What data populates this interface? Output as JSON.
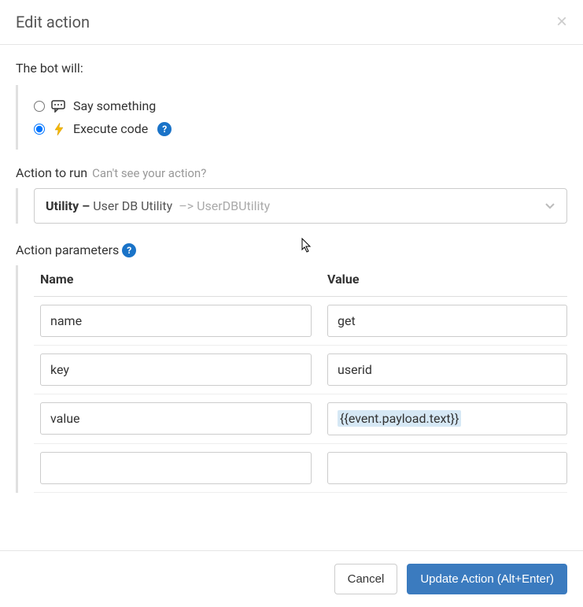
{
  "modal": {
    "title": "Edit action",
    "close_label": "×"
  },
  "bot_will": {
    "label": "The bot will:",
    "options": {
      "say": "Say something",
      "execute": "Execute code"
    },
    "selected": "execute"
  },
  "action_to_run": {
    "label": "Action to run",
    "hint": "Can't see your action?",
    "selected": {
      "category": "Utility –",
      "name": "User DB Utility",
      "identifier": "–> UserDBUtility"
    }
  },
  "action_parameters": {
    "label": "Action parameters",
    "columns": {
      "name": "Name",
      "value": "Value"
    },
    "rows": [
      {
        "name": "name",
        "value": "get"
      },
      {
        "name": "key",
        "value": "userid"
      },
      {
        "name": "value",
        "value": "{{event.payload.text}}",
        "highlighted": true
      },
      {
        "name": "",
        "value": ""
      }
    ]
  },
  "footer": {
    "cancel": "Cancel",
    "update": "Update Action (Alt+Enter)"
  },
  "help_icon": "?"
}
